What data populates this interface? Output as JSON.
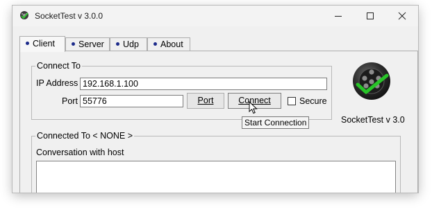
{
  "window": {
    "title": "SocketTest v 3.0.0",
    "controls": {
      "minimize": "minimize-icon",
      "maximize": "maximize-icon",
      "close": "close-icon"
    }
  },
  "tabs": [
    {
      "label": "Client",
      "active": true
    },
    {
      "label": "Server",
      "active": false
    },
    {
      "label": "Udp",
      "active": false
    },
    {
      "label": "About",
      "active": false
    }
  ],
  "connect_to": {
    "group_label": "Connect To",
    "ip_label": "IP Address",
    "ip_value": "192.168.1.100",
    "port_label": "Port",
    "port_value": "55776",
    "port_button": "Port",
    "connect_button": "Connect",
    "secure_label": "Secure",
    "secure_checked": false
  },
  "tooltip": "Start Connection",
  "logo": {
    "caption": "SocketTest v 3.0",
    "icon": "socket-plug-checkmark-icon"
  },
  "connected_to": {
    "group_label": "Connected To < NONE >",
    "conversation_label": "Conversation with host",
    "conversation_text": ""
  },
  "colors": {
    "tab_dot": "#1b2a8a",
    "check_green": "#2ecc2e"
  }
}
